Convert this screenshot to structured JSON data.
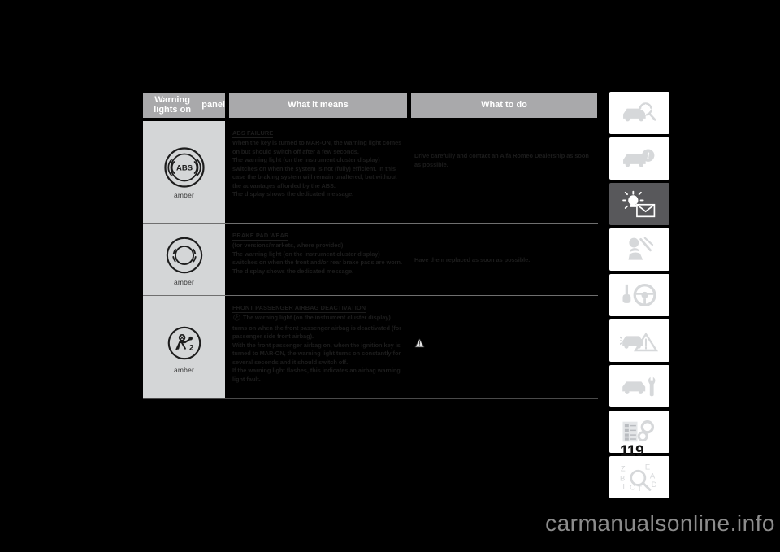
{
  "page": {
    "number": "119",
    "watermark": "carmanualsonline.info",
    "background_color": "#000000"
  },
  "table": {
    "headers": {
      "col1_line1": "Warning lights on",
      "col1_line2": "panel",
      "col2": "What it means",
      "col3": "What to do"
    },
    "header_bg": "#a9a9ab",
    "icon_cell_bg": "#d4d6d7",
    "rows": [
      {
        "lamp_icon": "abs-warning-icon",
        "lamp_color_label": "amber",
        "title": "ABS FAILURE",
        "means_paragraphs": [
          "When the key is turned to MAR-ON, the warning light comes on but should switch off after a few seconds.",
          "The warning light (on the instrument cluster display) switches on when the system is not (fully) efficient. In this case the braking system will remain unaltered, but without the advantages afforded by the ABS.",
          "The display shows the dedicated message."
        ],
        "do_text": "Drive carefully and contact an Alfa Romeo Dealership as soon as possible."
      },
      {
        "lamp_icon": "brake-pad-wear-icon",
        "lamp_color_label": "amber",
        "title": "BRAKE PAD WEAR",
        "means_paragraphs": [
          "(for versions/markets, where provided)",
          "The warning light (on the instrument cluster display) switches on when the front and/or rear brake pads are worn.",
          "The display shows the dedicated message."
        ],
        "do_text": "Have them replaced as soon as possible."
      },
      {
        "lamp_icon": "passenger-airbag-deactivation-icon",
        "lamp_color_label": "amber",
        "title": "FRONT PASSENGER AIRBAG DEACTIVATION",
        "means_paragraphs": [
          "The warning light (on the instrument cluster display) turns on when the front passenger airbag is deactivated (for passenger side front airbag).",
          "With the front passenger airbag on, when the ignition key is turned to MAR-ON, the warning light turns on constantly for several seconds and it should switch off.",
          "If the warning light flashes, this indicates an airbag warning light fault."
        ],
        "do_text_icon": "warning-triangle-icon",
        "do_text": ""
      }
    ]
  },
  "sidebar": {
    "items": [
      {
        "name": "dashboard-overview",
        "icon": "car-magnifier-icon",
        "active": false
      },
      {
        "name": "vehicle-information",
        "icon": "car-info-icon",
        "active": false
      },
      {
        "name": "warning-lights-messages",
        "icon": "lamp-envelope-icon",
        "active": true
      },
      {
        "name": "safety",
        "icon": "seatbelt-occupant-icon",
        "active": false
      },
      {
        "name": "starting-driving",
        "icon": "steering-wheel-key-icon",
        "active": false
      },
      {
        "name": "emergency",
        "icon": "car-hazard-triangle-icon",
        "active": false
      },
      {
        "name": "maintenance-care",
        "icon": "car-wrench-icon",
        "active": false
      },
      {
        "name": "technical-specifications",
        "icon": "list-gears-icon",
        "active": false
      },
      {
        "name": "alphabetical-index",
        "icon": "index-magnifier-icon",
        "active": false
      }
    ]
  }
}
